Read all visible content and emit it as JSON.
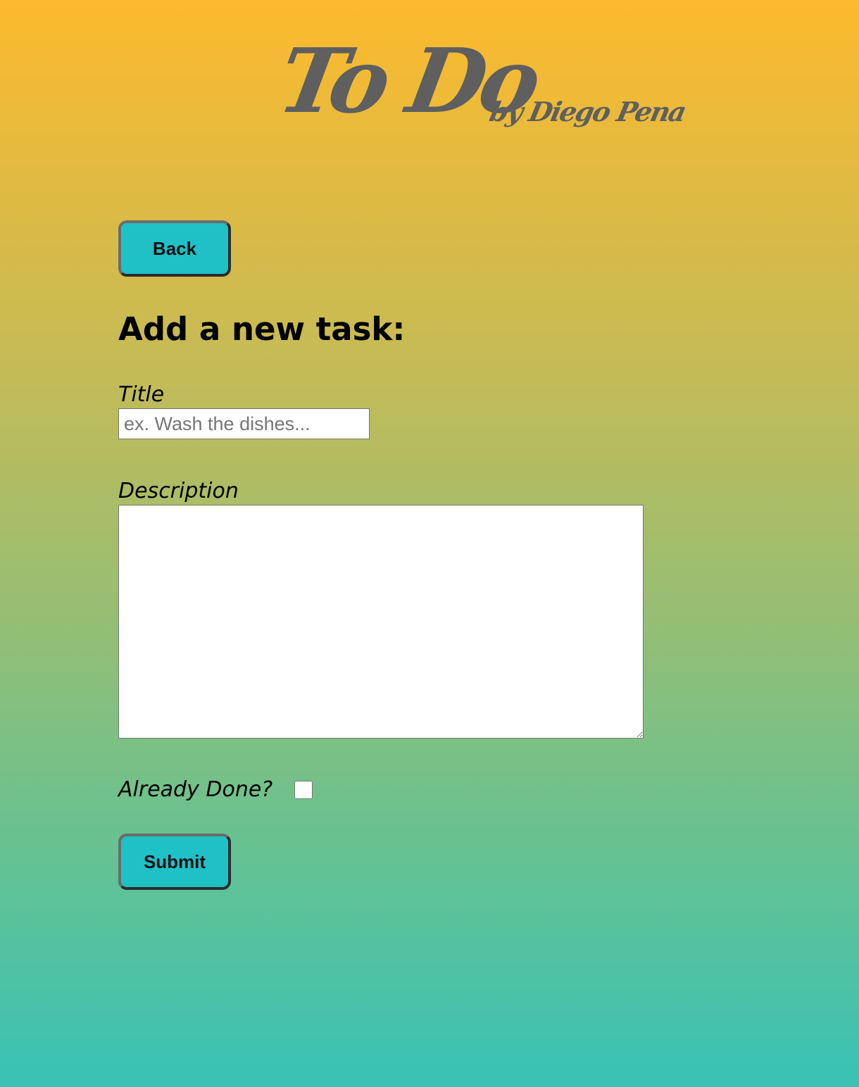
{
  "header": {
    "logo_main": "To Do",
    "logo_sub": "by Diego Pena"
  },
  "nav": {
    "back_label": "Back"
  },
  "form": {
    "heading": "Add a new task:",
    "title_label": "Title",
    "title_placeholder": "ex. Wash the dishes...",
    "title_value": "",
    "description_label": "Description",
    "description_value": "",
    "done_label": "Already Done?",
    "done_checked": false,
    "submit_label": "Submit"
  },
  "colors": {
    "gradient_top": "#fdba2d",
    "gradient_bottom": "#39c2b5",
    "button_bg": "#1fc1c7",
    "logo_text": "#5f5f5f"
  }
}
